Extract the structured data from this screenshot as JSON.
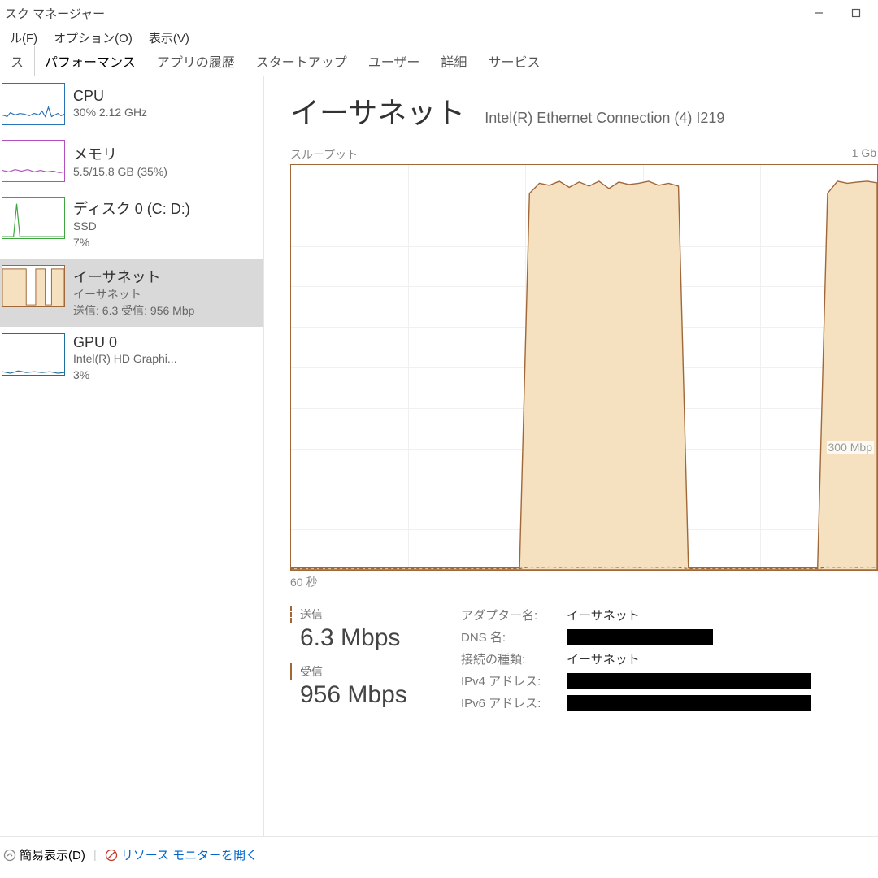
{
  "window": {
    "title": "スク マネージャー"
  },
  "menubar": {
    "file": "ル(F)",
    "options": "オプション(O)",
    "view": "表示(V)"
  },
  "tabs": {
    "processes": "ス",
    "performance": "パフォーマンス",
    "app_history": "アプリの履歴",
    "startup": "スタートアップ",
    "users": "ユーザー",
    "details": "詳細",
    "services": "サービス"
  },
  "sidebar": {
    "cpu": {
      "title": "CPU",
      "sub": "30%  2.12 GHz"
    },
    "memory": {
      "title": "メモリ",
      "sub": "5.5/15.8 GB (35%)"
    },
    "disk": {
      "title": "ディスク 0 (C: D:)",
      "sub1": "SSD",
      "sub2": "7%"
    },
    "ethernet": {
      "title": "イーサネット",
      "sub1": "イーサネット",
      "sub2": "送信: 6.3 受信: 956 Mbp"
    },
    "gpu": {
      "title": "GPU 0",
      "sub1": "Intel(R) HD Graphi...",
      "sub2": "3%"
    }
  },
  "main": {
    "title": "イーサネット",
    "adapter_full": "Intel(R) Ethernet Connection (4) I219",
    "chart_top_left": "スループット",
    "chart_top_right": "1 Gb",
    "chart_mid_label": "300 Mbp",
    "chart_bottom_left": "60 秒",
    "send_label": "送信",
    "send_value": "6.3 Mbps",
    "recv_label": "受信",
    "recv_value": "956 Mbps",
    "kv": {
      "adapter_name_k": "アダプター名:",
      "adapter_name_v": "イーサネット",
      "dns_k": "DNS 名:",
      "conn_type_k": "接続の種類:",
      "conn_type_v": "イーサネット",
      "ipv4_k": "IPv4 アドレス:",
      "ipv6_k": "IPv6 アドレス:"
    }
  },
  "footer": {
    "fewer": "簡易表示(D)",
    "resmon": "リソース モニターを開く"
  },
  "colors": {
    "cpu": "#2873b8",
    "memory": "#9b3ba8",
    "disk": "#3fa63f",
    "ethernet_stroke": "#a06838",
    "ethernet_fill": "#f5e0c0",
    "gpu": "#1d6f9c"
  },
  "chart_data": {
    "type": "area",
    "title": "スループット",
    "xlabel": "60 秒",
    "ylabel": "",
    "ylim": [
      0,
      1000
    ],
    "x_seconds": 60,
    "mid_gridline": 300,
    "series": [
      {
        "name": "受信",
        "unit": "Mbps",
        "values": [
          5,
          5,
          5,
          5,
          5,
          5,
          5,
          5,
          5,
          5,
          5,
          5,
          5,
          5,
          5,
          5,
          5,
          5,
          5,
          5,
          5,
          5,
          5,
          5,
          930,
          955,
          950,
          960,
          945,
          958,
          948,
          960,
          942,
          958,
          952,
          955,
          960,
          950,
          955,
          948,
          5,
          5,
          5,
          5,
          5,
          5,
          5,
          5,
          5,
          5,
          5,
          5,
          5,
          5,
          930,
          960,
          955,
          958,
          960,
          956
        ]
      },
      {
        "name": "送信",
        "unit": "Mbps",
        "values": [
          3,
          3,
          3,
          3,
          3,
          3,
          3,
          3,
          3,
          3,
          3,
          3,
          3,
          3,
          3,
          3,
          3,
          3,
          3,
          3,
          3,
          3,
          3,
          3,
          7,
          6,
          7,
          6,
          7,
          6,
          7,
          6,
          7,
          6,
          7,
          6,
          7,
          6,
          7,
          6,
          3,
          3,
          3,
          3,
          3,
          3,
          3,
          3,
          3,
          3,
          3,
          3,
          3,
          3,
          7,
          6,
          7,
          6,
          7,
          6
        ]
      }
    ]
  }
}
